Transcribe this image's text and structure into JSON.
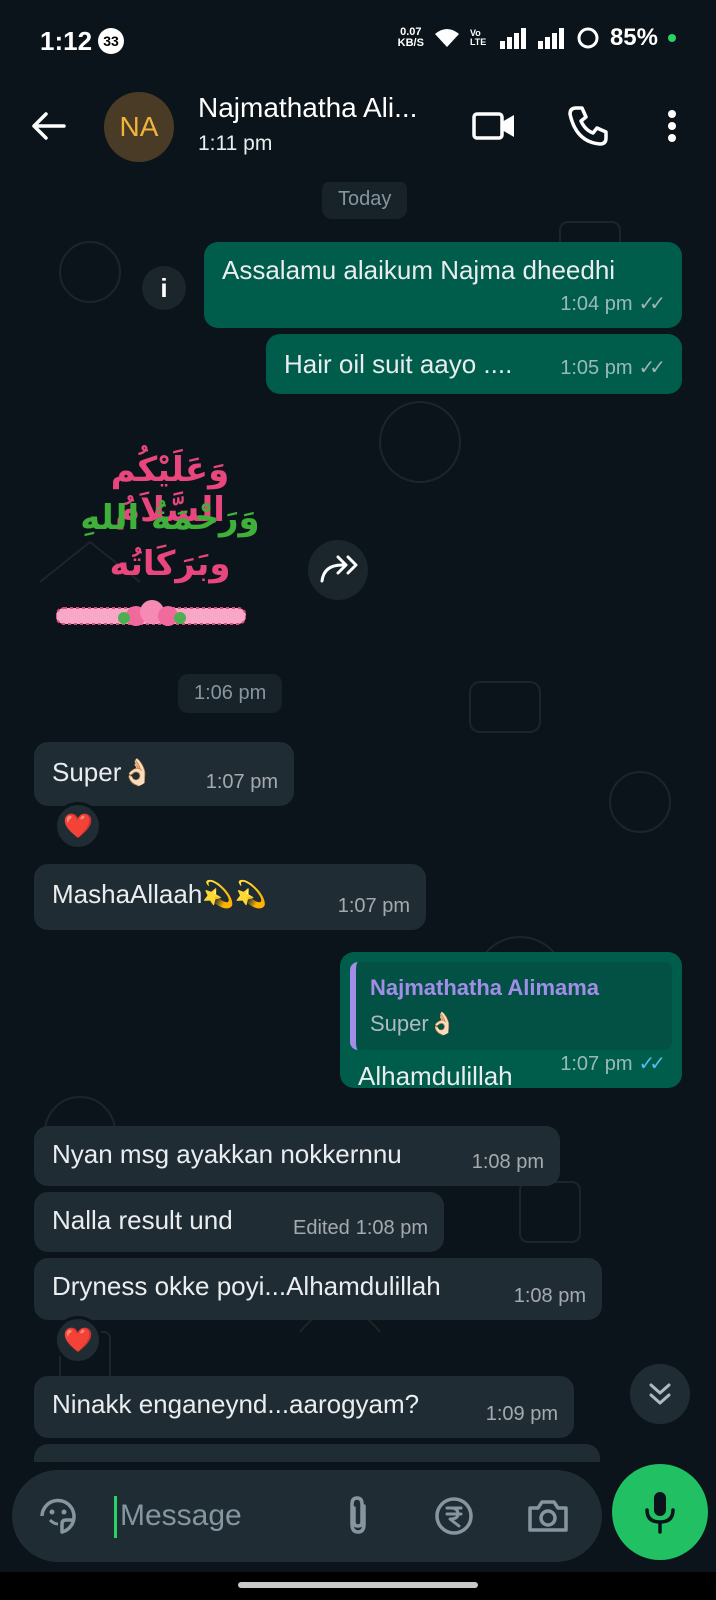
{
  "status_bar": {
    "time": "1:12",
    "notif_badge": "33",
    "net_speed_value": "0.07",
    "net_speed_unit": "KB/S",
    "volte": "Vo LTE",
    "battery": "85%"
  },
  "header": {
    "avatar_initials": "NA",
    "contact_name": "Najmathatha Ali...",
    "last_seen": "1:11 pm"
  },
  "chat": {
    "date_label": "Today",
    "time_label_1": "1:06 pm",
    "sticker": {
      "line1": "وَعَلَيْكُم السَّلاَمُ",
      "line2": "وَرَحْمَةُ اللهِ",
      "line3": "وبَرَكَاتُه"
    },
    "messages": [
      {
        "dir": "out",
        "text": "Assalamu alaikum Najma dheedhi",
        "time": "1:04 pm"
      },
      {
        "dir": "out",
        "text": "Hair oil suit aayo ....",
        "time": "1:05 pm"
      },
      {
        "dir": "in",
        "text": "Super👌🏻",
        "time": "1:07 pm"
      },
      {
        "dir": "in",
        "text": "MashaAllaah💫💫",
        "time": "1:07 pm"
      },
      {
        "dir": "out",
        "text": "Alhamdulillah",
        "time": "1:07 pm",
        "quote_name": "Najmathatha Alimama",
        "quote_text": "Super👌🏻"
      },
      {
        "dir": "in",
        "text": "Nyan msg ayakkan nokkernnu",
        "time": "1:08 pm"
      },
      {
        "dir": "in",
        "text": "Nalla result und",
        "time": "1:08 pm",
        "edited": "Edited"
      },
      {
        "dir": "in",
        "text": "Dryness okke poyi...Alhamdulillah",
        "time": "1:08 pm"
      },
      {
        "dir": "in",
        "text": "Ninakk enganeynd...aarogyam?",
        "time": "1:09 pm"
      }
    ],
    "reaction": "❤️"
  },
  "input": {
    "placeholder": "Message"
  },
  "colors": {
    "outgoing": "#005c4b",
    "incoming": "#202c33",
    "accent": "#21c063",
    "read_ticks": "#53bdeb"
  }
}
